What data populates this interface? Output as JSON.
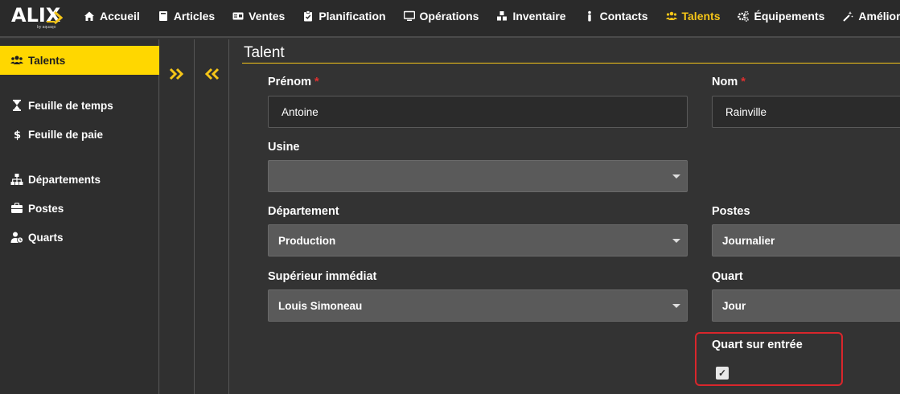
{
  "topnav": {
    "logo_text": "ALIX",
    "logo_sub": "by aquaqo",
    "items": [
      {
        "label": "Accueil",
        "icon": "home-icon"
      },
      {
        "label": "Articles",
        "icon": "book-icon"
      },
      {
        "label": "Ventes",
        "icon": "card-icon"
      },
      {
        "label": "Planification",
        "icon": "clipboard-check-icon"
      },
      {
        "label": "Opérations",
        "icon": "monitor-icon"
      },
      {
        "label": "Inventaire",
        "icon": "cubes-icon"
      },
      {
        "label": "Contacts",
        "icon": "person-icon"
      },
      {
        "label": "Talents",
        "icon": "users-icon",
        "active": true
      },
      {
        "label": "Équipements",
        "icon": "gears-icon"
      },
      {
        "label": "Améliora",
        "icon": "magic-wand-icon"
      }
    ],
    "accent_color": "#f5c518"
  },
  "sidebar": {
    "items": [
      {
        "label": "Talents",
        "icon": "users-icon",
        "active": true
      },
      {
        "label": "Feuille de temps",
        "icon": "hourglass-icon"
      },
      {
        "label": "Feuille de paie",
        "icon": "dollar-icon"
      },
      {
        "label": "Départements",
        "icon": "sitemap-icon"
      },
      {
        "label": "Postes",
        "icon": "briefcase-icon"
      },
      {
        "label": "Quarts",
        "icon": "user-clock-icon"
      }
    ],
    "active_color": "#ffd700"
  },
  "form": {
    "title": "Talent",
    "prenom": {
      "label": "Prénom",
      "required": "*",
      "value": "Antoine"
    },
    "nom": {
      "label": "Nom",
      "required": "*",
      "value": "Rainville"
    },
    "usine": {
      "label": "Usine",
      "value": ""
    },
    "departement": {
      "label": "Département",
      "value": "Production"
    },
    "postes": {
      "label": "Postes",
      "value": "Journalier"
    },
    "superieur": {
      "label": "Supérieur immédiat",
      "value": "Louis Simoneau"
    },
    "quart": {
      "label": "Quart",
      "value": "Jour"
    },
    "quart_sur_entree": {
      "label": "Quart sur entrée",
      "checked": true,
      "check_glyph": "✓"
    }
  }
}
